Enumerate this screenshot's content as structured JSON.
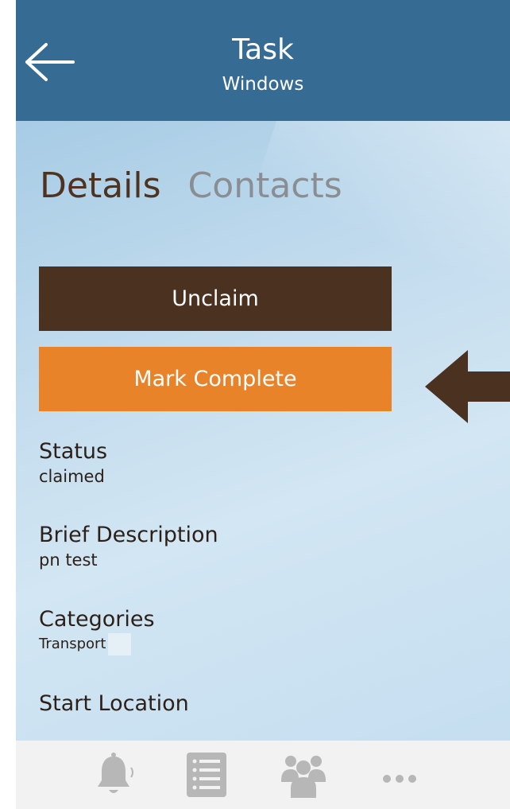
{
  "header": {
    "title": "Task",
    "subtitle": "Windows",
    "background_color": "#366c94",
    "back_icon": "arrow-left-icon"
  },
  "tabs": [
    {
      "label": "Details",
      "active": true
    },
    {
      "label": "Contacts",
      "active": false
    }
  ],
  "actions": {
    "unclaim_label": "Unclaim",
    "unclaim_color": "#4a3120",
    "complete_label": "Mark Complete",
    "complete_color": "#e8832a"
  },
  "annotation": {
    "icon": "arrow-left-icon",
    "color": "#4a3120"
  },
  "fields": {
    "status": {
      "label": "Status",
      "value": "claimed"
    },
    "brief_description": {
      "label": "Brief Description",
      "value": "pn test"
    },
    "categories": {
      "label": "Categories",
      "value": "Transport"
    },
    "start_location": {
      "label": "Start Location"
    }
  },
  "bottom_bar": {
    "icons": [
      "bell-icon",
      "list-icon",
      "people-icon",
      "more-icon"
    ],
    "icon_color": "#b7b7b7"
  }
}
